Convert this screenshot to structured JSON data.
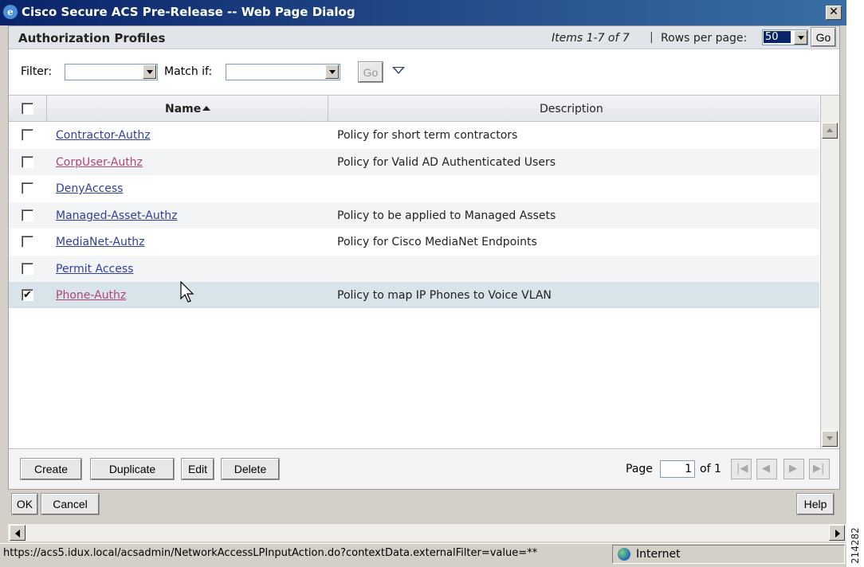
{
  "window": {
    "title": "Cisco Secure ACS Pre-Release -- Web Page Dialog",
    "close_label": "✕"
  },
  "panel": {
    "title": "Authorization Profiles",
    "items_info": "Items 1-7 of 7",
    "separator": "|",
    "rows_per_page_label": "Rows per page:",
    "rows_per_page_value": "50",
    "go_label": "Go"
  },
  "filter": {
    "filter_label": "Filter:",
    "filter_value": "",
    "match_label": "Match if:",
    "match_value": "",
    "go_label": "Go"
  },
  "grid": {
    "columns": {
      "name": "Name",
      "description": "Description"
    },
    "rows": [
      {
        "name": "Contractor-Authz",
        "description": "Policy for short term contractors",
        "checked": false
      },
      {
        "name": "CorpUser-Authz",
        "description": "Policy for Valid AD Authenticated Users",
        "checked": false
      },
      {
        "name": "DenyAccess",
        "description": "",
        "checked": false
      },
      {
        "name": "Managed-Asset-Authz",
        "description": "Policy to be applied to Managed Assets",
        "checked": false
      },
      {
        "name": "MediaNet-Authz",
        "description": "Policy for Cisco MediaNet Endpoints",
        "checked": false
      },
      {
        "name": "Permit Access",
        "description": "",
        "checked": false
      },
      {
        "name": "Phone-Authz",
        "description": "Policy to map IP Phones to Voice VLAN",
        "checked": true
      }
    ]
  },
  "footer": {
    "create_label": "Create",
    "duplicate_label": "Duplicate",
    "edit_label": "Edit",
    "delete_label": "Delete",
    "page_label": "Page",
    "page_value": "1",
    "of_label": "of 1"
  },
  "dialog": {
    "ok_label": "OK",
    "cancel_label": "Cancel",
    "help_label": "Help"
  },
  "statusbar": {
    "url": "https://acs5.idux.local/acsadmin/NetworkAccessLPInputAction.do?contextData.externalFilter=value=**",
    "zone": "Internet"
  },
  "side_code": "214282",
  "colors": {
    "title_start": "#0a246a",
    "title_end": "#3a6ea5",
    "link": "#2f3f9f",
    "link_visited": "#b0457a",
    "row_alt": "#f3f4f6",
    "row_selected": "#d9e3ea"
  }
}
